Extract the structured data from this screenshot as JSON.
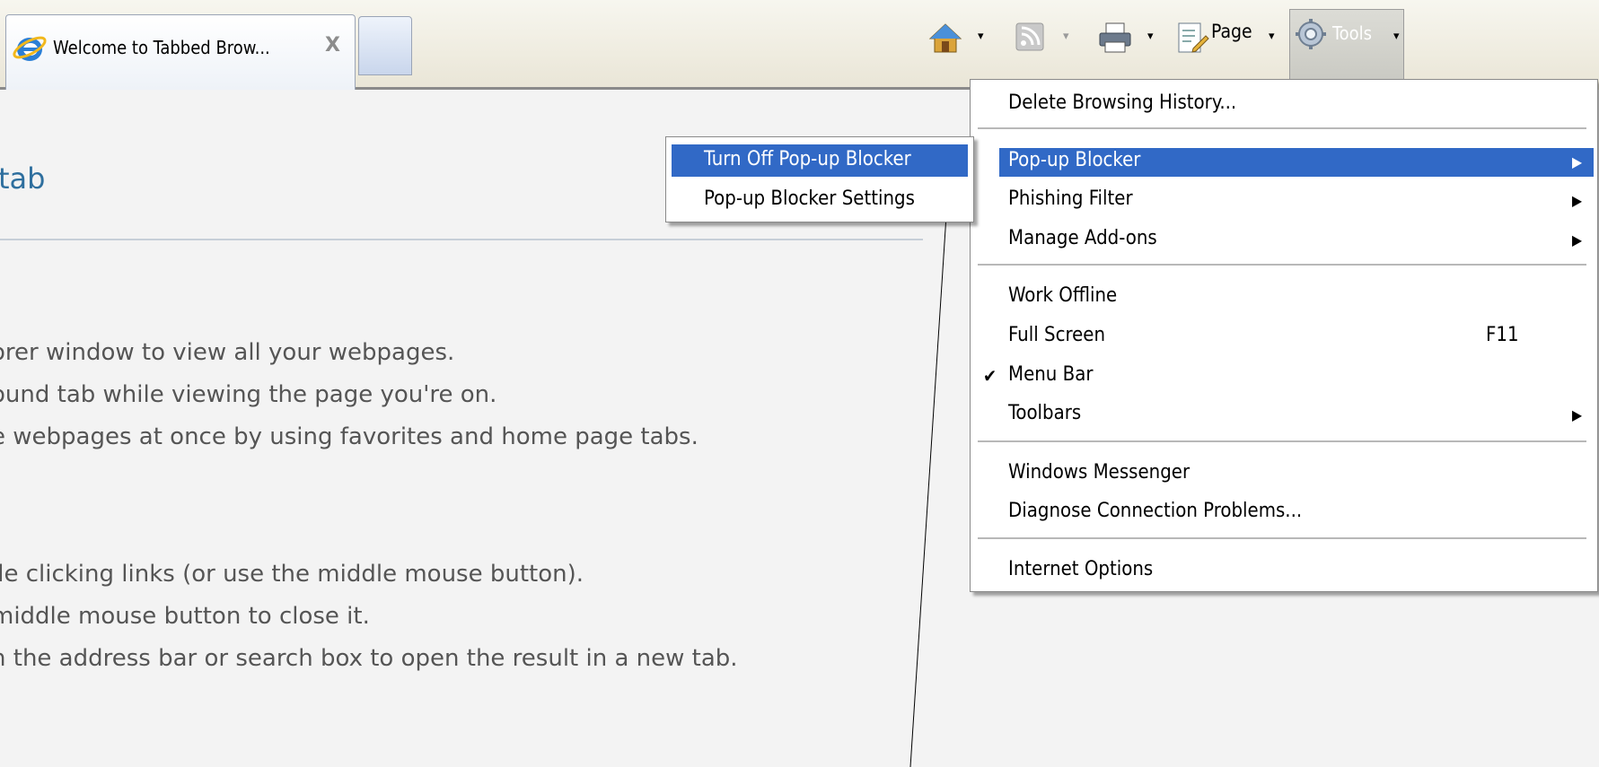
{
  "tab": {
    "title": "Welcome to Tabbed Brow...",
    "close_glyph": "X"
  },
  "command_bar": {
    "home_icon": "home-icon",
    "feeds_icon": "rss-feed-icon",
    "print_icon": "printer-icon",
    "page_icon": "page-icon",
    "page_label": "Page",
    "tools_icon": "gear-icon",
    "tools_label": "Tools",
    "dropdown_glyph": "▾"
  },
  "content": {
    "heading": "tab",
    "lines": [
      "orer window to view all your webpages.",
      "ound tab while viewing the page you're on.",
      "e webpages at once by using favorites and home page tabs.",
      "ile clicking links (or use the middle mouse button).",
      "middle mouse button to close it.",
      "n the address bar or search box to open the result in a new tab."
    ]
  },
  "tools_menu": {
    "items": {
      "delete_history": "Delete Browsing History...",
      "popup_blocker": "Pop-up Blocker",
      "phishing_filter": "Phishing Filter",
      "manage_addons": "Manage Add-ons",
      "work_offline": "Work Offline",
      "full_screen": "Full Screen",
      "full_screen_shortcut": "F11",
      "menu_bar": "Menu Bar",
      "toolbars": "Toolbars",
      "windows_messenger": "Windows Messenger",
      "diagnose": "Diagnose Connection Problems...",
      "internet_options": "Internet Options"
    },
    "checked_glyph": "✔",
    "submenu_glyph": "▶"
  },
  "popup_submenu": {
    "turn_off": "Turn Off Pop-up Blocker",
    "settings": "Pop-up Blocker Settings"
  },
  "colors": {
    "highlight": "#3169c6",
    "heading": "#2e6f9e",
    "body_text": "#555555"
  }
}
